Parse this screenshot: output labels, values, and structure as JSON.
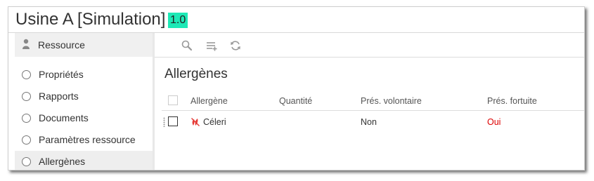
{
  "window": {
    "title": "Usine A [Simulation]",
    "version": "1.0",
    "version_color": "#1de9b6"
  },
  "sidebar": {
    "header": {
      "icon": "user-icon",
      "label": "Ressource"
    },
    "items": [
      {
        "label": "Propriétés",
        "icon": "radio-icon",
        "active": false
      },
      {
        "label": "Rapports",
        "icon": "radio-icon",
        "active": false
      },
      {
        "label": "Documents",
        "icon": "radio-icon",
        "active": false
      },
      {
        "label": "Paramètres ressource",
        "icon": "radio-icon",
        "active": false
      },
      {
        "label": "Allergènes",
        "icon": "radio-icon",
        "active": true
      }
    ]
  },
  "toolbar": {
    "tools": [
      {
        "icon": "search-icon"
      },
      {
        "icon": "add-list-icon"
      },
      {
        "icon": "refresh-icon"
      }
    ]
  },
  "main": {
    "title": "Allergènes",
    "table": {
      "columns": [
        "Allergène",
        "Quantité",
        "Prés. volontaire",
        "Prés. fortuite"
      ],
      "rows": [
        {
          "icon": "allergen-icon",
          "allergene": "Céleri",
          "quantite": "",
          "pres_volontaire": "Non",
          "pres_fortuite": "Oui",
          "pres_fortuite_color": "#dd0000"
        }
      ]
    }
  }
}
